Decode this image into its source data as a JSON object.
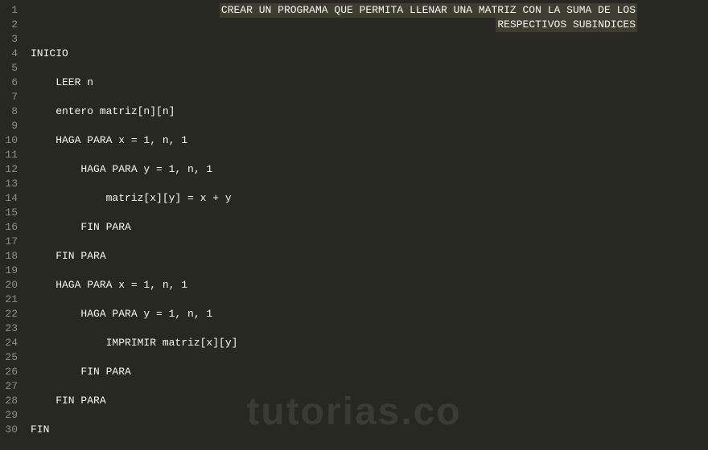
{
  "editor": {
    "lines": [
      {
        "num": "1",
        "content": "CREAR·UN·PROGRAMA·QUE·PERMITA·LLENAR·UNA·MATRIZ·CON·LA·SUMA·DE·LOS",
        "rightAlign": true,
        "highlight": true
      },
      {
        "num": "2",
        "content": "RESPECTIVOS·SUBINDICES",
        "rightAlign": true,
        "highlight": true
      },
      {
        "num": "3",
        "content": ""
      },
      {
        "num": "4",
        "content": "INICIO"
      },
      {
        "num": "5",
        "content": ""
      },
      {
        "num": "6",
        "content": "    LEER n"
      },
      {
        "num": "7",
        "content": ""
      },
      {
        "num": "8",
        "content": "    entero matriz[n][n]"
      },
      {
        "num": "9",
        "content": ""
      },
      {
        "num": "10",
        "content": "    HAGA PARA x = 1, n, 1"
      },
      {
        "num": "11",
        "content": ""
      },
      {
        "num": "12",
        "content": "        HAGA PARA y = 1, n, 1"
      },
      {
        "num": "13",
        "content": ""
      },
      {
        "num": "14",
        "content": "            matriz[x][y] = x + y"
      },
      {
        "num": "15",
        "content": ""
      },
      {
        "num": "16",
        "content": "        FIN PARA"
      },
      {
        "num": "17",
        "content": ""
      },
      {
        "num": "18",
        "content": "    FIN PARA"
      },
      {
        "num": "19",
        "content": ""
      },
      {
        "num": "20",
        "content": "    HAGA PARA x = 1, n, 1"
      },
      {
        "num": "21",
        "content": ""
      },
      {
        "num": "22",
        "content": "        HAGA PARA y = 1, n, 1"
      },
      {
        "num": "23",
        "content": ""
      },
      {
        "num": "24",
        "content": "            IMPRIMIR matriz[x][y]"
      },
      {
        "num": "25",
        "content": ""
      },
      {
        "num": "26",
        "content": "        FIN PARA"
      },
      {
        "num": "27",
        "content": ""
      },
      {
        "num": "28",
        "content": "    FIN PARA"
      },
      {
        "num": "29",
        "content": ""
      },
      {
        "num": "30",
        "content": "FIN"
      }
    ]
  },
  "watermark": "tutorias.co"
}
